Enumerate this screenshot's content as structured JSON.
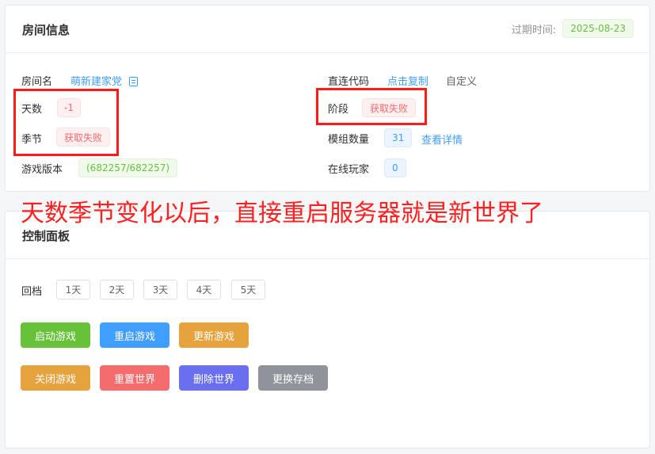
{
  "room_card": {
    "title": "房间信息",
    "expire_label": "过期时间:",
    "expire_value": "2025-08-23",
    "room_name_label": "房间名",
    "room_name_value": "萌新建家党",
    "days_label": "天数",
    "days_value": "-1",
    "season_label": "季节",
    "season_value": "获取失败",
    "version_label": "游戏版本",
    "version_value": "(682257/682257)",
    "direct_code_label": "直连代码",
    "direct_code_link": "点击复制",
    "direct_code_custom": "自定义",
    "stage_label": "阶段",
    "stage_value": "获取失败",
    "mod_count_label": "模组数量",
    "mod_count_value": "31",
    "mod_detail_link": "查看详情",
    "online_label": "在线玩家",
    "online_value": "0"
  },
  "annotation": "天数季节变化以后，直接重启服务器就是新世界了",
  "control_card": {
    "title": "控制面板",
    "rollback_label": "回档",
    "rollback_days": [
      "1天",
      "2天",
      "3天",
      "4天",
      "5天"
    ],
    "buttons": {
      "start": "启动游戏",
      "restart": "重启游戏",
      "update": "更新游戏",
      "stop": "关闭游戏",
      "reset": "重置世界",
      "delete": "删除世界",
      "switch": "更换存档"
    }
  },
  "colors": {
    "start": "#67c23a",
    "restart": "#409eff",
    "update": "#e6a23c",
    "stop": "#e6a23c",
    "reset": "#f56c6c",
    "delete": "#6a6ff0",
    "switch": "#909399",
    "annotation": "#ff2020"
  }
}
